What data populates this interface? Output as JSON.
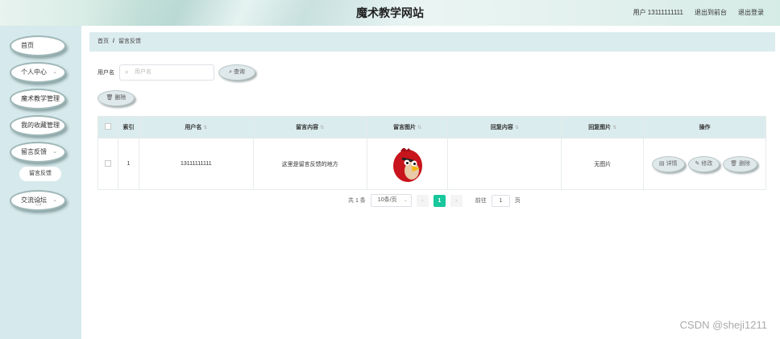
{
  "header": {
    "site_title": "魔术教学网站",
    "user_label": "用户 13111111111",
    "back_front": "退出到前台",
    "logout": "退出登录"
  },
  "sidebar": {
    "items": [
      {
        "label": "首页",
        "has_chevron": false
      },
      {
        "label": "个人中心",
        "has_chevron": true
      },
      {
        "label": "魔术教学管理",
        "has_chevron": false
      },
      {
        "label": "我的收藏管理",
        "has_chevron": false
      },
      {
        "label": "留言反馈",
        "has_chevron": true
      },
      {
        "label": "交流论坛",
        "has_chevron": true
      }
    ],
    "submenu": "留言反馈",
    "chevron": "⌄"
  },
  "breadcrumb": {
    "home": "首页",
    "sep": "/",
    "current": "留言反馈"
  },
  "search": {
    "label": "用户名",
    "placeholder": "用户名",
    "search_icon": "⌕",
    "query_button": "查询",
    "delete_button": "删除"
  },
  "table": {
    "headers": [
      "索引",
      "用户名",
      "留言内容",
      "留言图片",
      "回复内容",
      "回复图片",
      "操作"
    ],
    "sort_mark": "⇅",
    "rows": [
      {
        "index": "1",
        "username": "13111111111",
        "content": "这里是留言反馈的地方",
        "image": "angry-bird",
        "reply": "",
        "reply_image": "无图片",
        "actions": {
          "detail": "详情",
          "edit": "修改",
          "delete": "删除"
        }
      }
    ]
  },
  "pagination": {
    "total": "共 1 条",
    "page_size": "10条/页",
    "current_page": "1",
    "goto_label": "前往",
    "goto_value": "1",
    "page_unit": "页",
    "prev": "‹",
    "next": "›"
  },
  "watermark": "CSDN @sheji1211",
  "colors": {
    "accent": "#18c79c",
    "sidebar_bg": "#d6e9ec",
    "header_row": "#dbecee"
  }
}
